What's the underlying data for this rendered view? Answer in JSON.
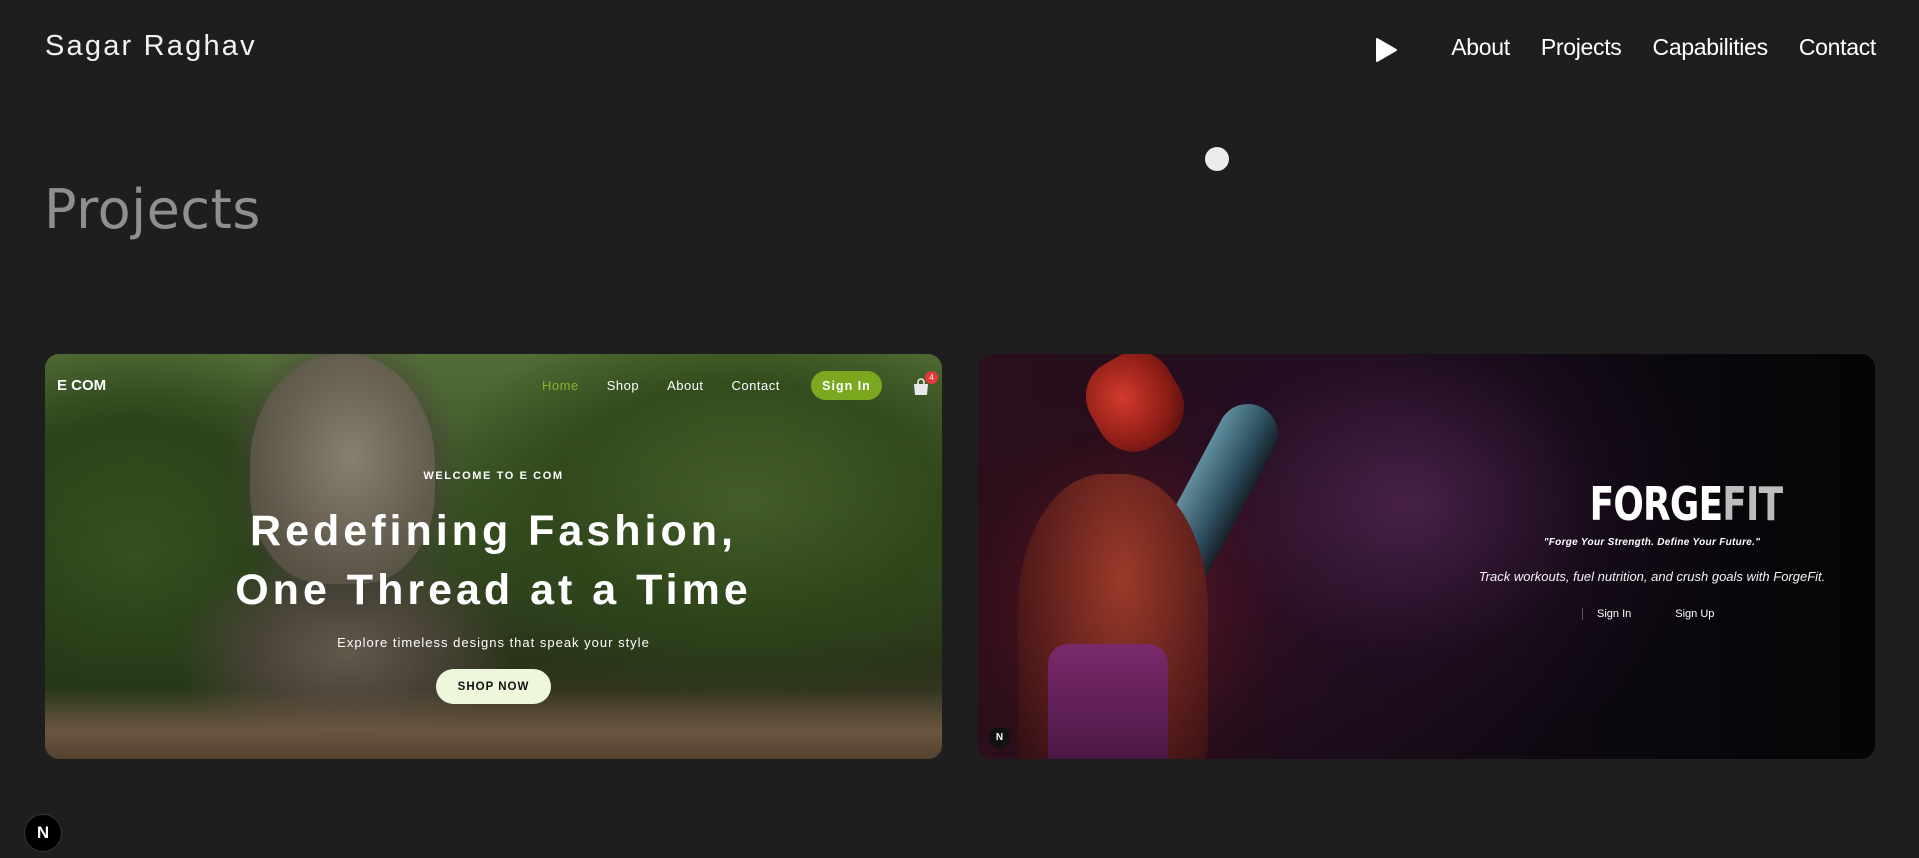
{
  "header": {
    "brand": "Sagar Raghav",
    "play_icon": "play-icon",
    "nav": [
      "About",
      "Projects",
      "Capabilities",
      "Contact"
    ]
  },
  "main": {
    "section_title": "Projects"
  },
  "projects": [
    {
      "logo": "E COM",
      "nav": [
        "Home",
        "Shop",
        "About",
        "Contact"
      ],
      "active_nav": "Home",
      "sign_in": "Sign In",
      "cart_icon": "shopping-bag-icon",
      "cart_count": "4",
      "kicker": "WELCOME TO E COM",
      "headline_line1": "Redefining Fashion,",
      "headline_line2": "One Thread at a Time",
      "subtitle": "Explore timeless designs that speak your style",
      "cta": "SHOP NOW",
      "accent_color": "#7ca81f"
    },
    {
      "logo_main": "FORGE",
      "logo_accent": "FIT",
      "slogan": "\"Forge Your Strength. Define Your Future.\"",
      "description": "Track workouts, fuel nutrition, and crush goals with ForgeFit.",
      "sign_in": "Sign In",
      "sign_up": "Sign Up",
      "badge": "N"
    }
  ],
  "dev_badge": "N"
}
